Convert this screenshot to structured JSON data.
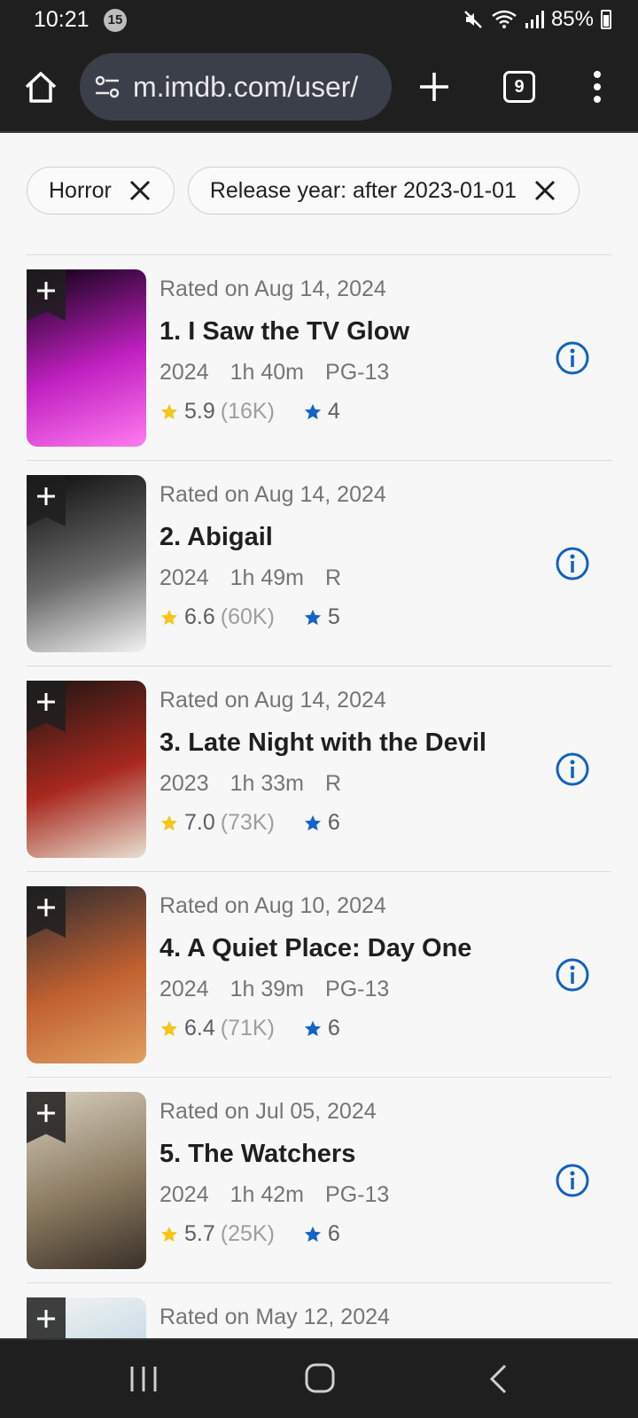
{
  "status": {
    "time": "10:21",
    "notif_count": "15",
    "battery": "85%"
  },
  "browser": {
    "url": "m.imdb.com/user/",
    "tab_count": "9"
  },
  "filters": [
    {
      "label": "Horror"
    },
    {
      "label": "Release year: after 2023-01-01"
    }
  ],
  "items": [
    {
      "rated": "Rated on Aug 14, 2024",
      "title": "1. I Saw the TV Glow",
      "year": "2024",
      "runtime": "1h 40m",
      "cert": "PG-13",
      "rating": "5.9",
      "votes": "(16K)",
      "user_rating": "4",
      "poster_colors": [
        "#0a0010",
        "#c020c0",
        "#ff7bf0"
      ]
    },
    {
      "rated": "Rated on Aug 14, 2024",
      "title": "2. Abigail",
      "year": "2024",
      "runtime": "1h 49m",
      "cert": "R",
      "rating": "6.6",
      "votes": "(60K)",
      "user_rating": "5",
      "poster_colors": [
        "#0b0b0b",
        "#6a6a6a",
        "#f2f2f2"
      ]
    },
    {
      "rated": "Rated on Aug 14, 2024",
      "title": "3. Late Night with the Devil",
      "year": "2023",
      "runtime": "1h 33m",
      "cert": "R",
      "rating": "7.0",
      "votes": "(73K)",
      "user_rating": "6",
      "poster_colors": [
        "#1b1613",
        "#a8281e",
        "#e8e0d0"
      ]
    },
    {
      "rated": "Rated on Aug 10, 2024",
      "title": "4. A Quiet Place: Day One",
      "year": "2024",
      "runtime": "1h 39m",
      "cert": "PG-13",
      "rating": "6.4",
      "votes": "(71K)",
      "user_rating": "6",
      "poster_colors": [
        "#2a2a30",
        "#c06030",
        "#e0a060"
      ]
    },
    {
      "rated": "Rated on Jul 05, 2024",
      "title": "5. The Watchers",
      "year": "2024",
      "runtime": "1h 42m",
      "cert": "PG-13",
      "rating": "5.7",
      "votes": "(25K)",
      "user_rating": "6",
      "poster_colors": [
        "#d8d0c0",
        "#8a7a60",
        "#3a3028"
      ]
    },
    {
      "rated": "Rated on May 12, 2024",
      "title": "",
      "year": "",
      "runtime": "",
      "cert": "",
      "rating": "",
      "votes": "",
      "user_rating": "",
      "poster_colors": [
        "#f4f4f4",
        "#bcd4e0",
        "#6a8a9a"
      ]
    }
  ],
  "colors": {
    "accent_blue": "#0e63be",
    "star_gold": "#f5c518",
    "user_star_blue": "#1464c8"
  }
}
